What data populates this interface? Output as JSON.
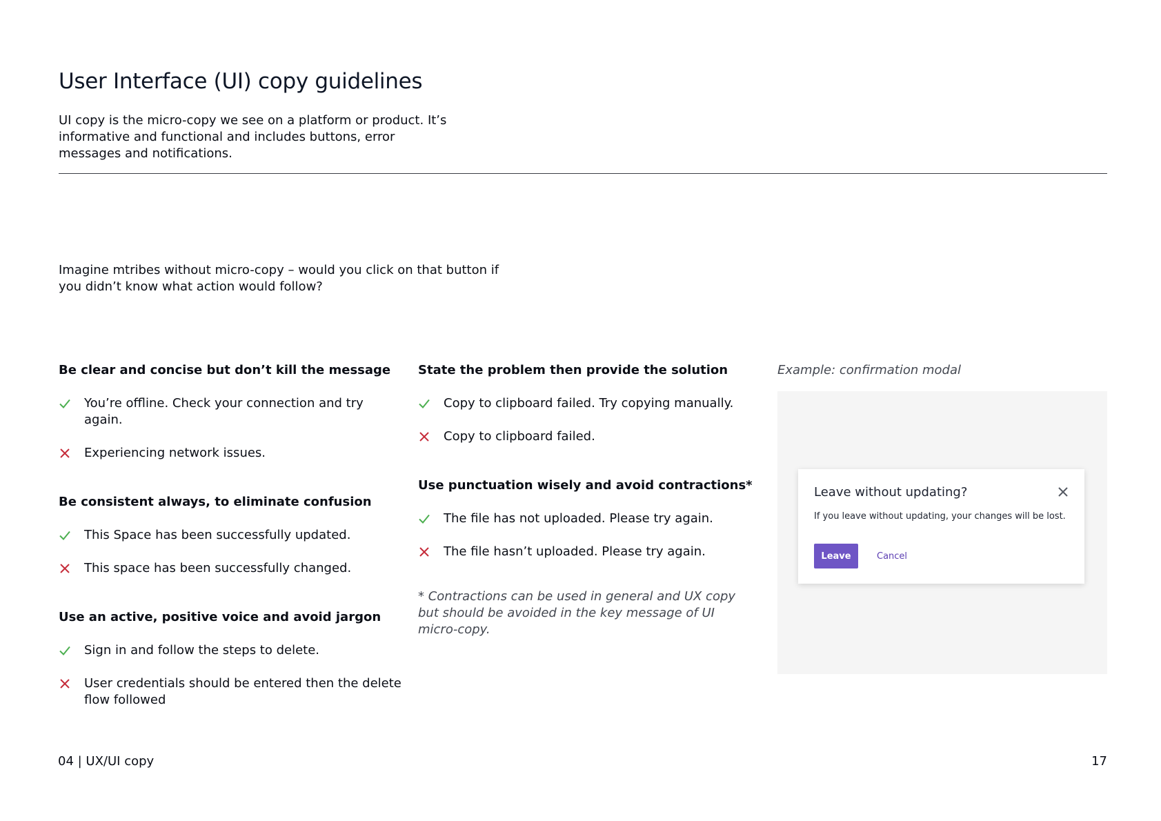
{
  "header": {
    "title": "User Interface (UI) copy guidelines",
    "intro": "UI copy is the micro-copy we see on a platform or product. It’s informative and functional and includes buttons, error messages and notifications."
  },
  "lead": "Imagine mtribes without micro-copy – would you click on that button if you didn’t know what action would follow?",
  "colors": {
    "check": "#4caf50",
    "cross": "#c62c3a",
    "accent": "#6e55c5",
    "panel": "#f5f5f5"
  },
  "icons": {
    "good": "check-icon",
    "bad": "cross-icon",
    "close": "close-icon"
  },
  "guidelines": [
    {
      "heading": "Be clear and concise but don’t kill the message",
      "good": "You’re offline. Check your connection and try again.",
      "bad": "Experiencing network issues."
    },
    {
      "heading": "Be consistent always, to eliminate confusion",
      "good": "This Space has been successfully updated.",
      "bad": "This space has been successfully changed."
    },
    {
      "heading": "Use an active, positive voice and avoid jargon",
      "good": "Sign in and follow the steps to delete.",
      "bad": "User credentials should be entered then the delete flow followed"
    },
    {
      "heading": "State the problem then provide the solution",
      "good": "Copy to clipboard failed. Try copying manually.",
      "bad": "Copy to clipboard failed."
    },
    {
      "heading": "Use punctuation wisely and avoid contractions*",
      "good": "The file has not uploaded. Please try again.",
      "bad": "The file hasn’t uploaded. Please try again."
    }
  ],
  "footnote": "* Contractions can be used in general and UX copy but should be avoided in the key message of UI micro-copy.",
  "example": {
    "caption": "Example: confirmation modal",
    "modal": {
      "title": "Leave without updating?",
      "body": "If you leave without updating, your changes will be lost.",
      "primary_label": "Leave",
      "secondary_label": "Cancel"
    }
  },
  "footer": {
    "section": "04 | UX/UI copy",
    "page_number": "17"
  }
}
